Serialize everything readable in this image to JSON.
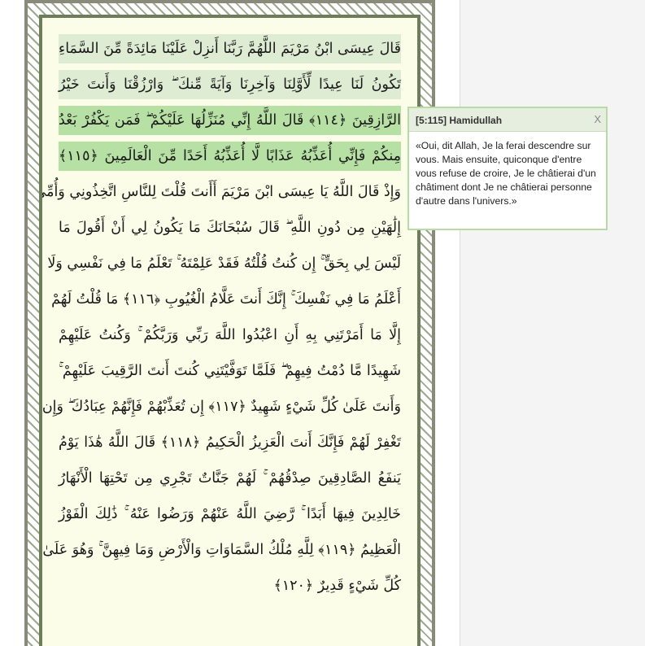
{
  "quran_page": {
    "lines": [
      "قَالَ عِيسَى ابْنُ مَرْيَمَ اللَّهُمَّ رَبَّنَا أَنزِلْ عَلَيْنَا مَائِدَةً مِّنَ السَّمَاءِ",
      "تَكُونُ لَنَا عِيدًا لِّأَوَّلِنَا وَآخِرِنَا وَآيَةً مِّنكَ ۖ وَارْزُقْنَا وَأَنتَ خَيْرُ",
      "الرَّازِقِينَ ﴿١١٤﴾ قَالَ اللَّهُ إِنِّي مُنَزِّلُهَا عَلَيْكُمْ ۖ فَمَن يَكْفُرْ بَعْدُ",
      "مِنكُمْ فَإِنِّي أُعَذِّبُهُ عَذَابًا لَّا أُعَذِّبُهُ أَحَدًا مِّنَ الْعَالَمِينَ ﴿١١٥﴾",
      "وَإِذْ قَالَ اللَّهُ يَا عِيسَى ابْنَ مَرْيَمَ أَأَنتَ قُلْتَ لِلنَّاسِ اتَّخِذُونِي وَأُمِّيَ",
      "إِلَٰهَيْنِ مِن دُونِ اللَّهِ ۖ قَالَ سُبْحَانَكَ مَا يَكُونُ لِي أَنْ أَقُولَ مَا",
      "لَيْسَ لِي بِحَقٍّ ۚ إِن كُنتُ قُلْتُهُ فَقَدْ عَلِمْتَهُ ۚ تَعْلَمُ مَا فِي نَفْسِي وَلَا",
      "أَعْلَمُ مَا فِي نَفْسِكَ ۚ إِنَّكَ أَنتَ عَلَّامُ الْغُيُوبِ ﴿١١٦﴾ مَا قُلْتُ لَهُمْ",
      "إِلَّا مَا أَمَرْتَنِي بِهِ أَنِ اعْبُدُوا اللَّهَ رَبِّي وَرَبَّكُمْ ۚ وَكُنتُ عَلَيْهِمْ",
      "شَهِيدًا مَّا دُمْتُ فِيهِمْ ۖ فَلَمَّا تَوَفَّيْتَنِي كُنتَ أَنتَ الرَّقِيبَ عَلَيْهِمْ ۚ",
      "وَأَنتَ عَلَىٰ كُلِّ شَيْءٍ شَهِيدٌ ﴿١١٧﴾ إِن تُعَذِّبْهُمْ فَإِنَّهُمْ عِبَادُكَ ۖ وَإِن",
      "تَغْفِرْ لَهُمْ فَإِنَّكَ أَنتَ الْعَزِيزُ الْحَكِيمُ ﴿١١٨﴾ قَالَ اللَّهُ هَٰذَا يَوْمُ",
      "يَنفَعُ الصَّادِقِينَ صِدْقُهُمْ ۚ لَهُمْ جَنَّاتٌ تَجْرِي مِن تَحْتِهَا الْأَنْهَارُ",
      "خَالِدِينَ فِيهَا أَبَدًا ۚ رَّضِيَ اللَّهُ عَنْهُمْ وَرَضُوا عَنْهُ ۚ ذَٰلِكَ الْفَوْزُ",
      "الْعَظِيمُ ﴿١١٩﴾ لِلَّهِ مُلْكُ السَّمَاوَاتِ وَالْأَرْضِ وَمَا فِيهِنَّ ۚ وَهُوَ عَلَىٰ",
      "كُلِّ شَيْءٍ قَدِيرٌ ﴿١٢٠﴾"
    ]
  },
  "translation_popup": {
    "title": "[5:115] Hamidullah",
    "close_label": "X",
    "text": "«Oui, dit Allah, Je la ferai descendre sur vous. Mais ensuite, quiconque d'entre vous refuse de croire, Je le châtierai d'un châtiment dont Je ne châtierai personne d'autre dans l'univers.»"
  },
  "colors": {
    "page_background": "#fbfde8",
    "highlight_previous": "#dfecd4",
    "highlight_selected": "#b7e0a4",
    "popup_border": "#b9d9a5"
  }
}
